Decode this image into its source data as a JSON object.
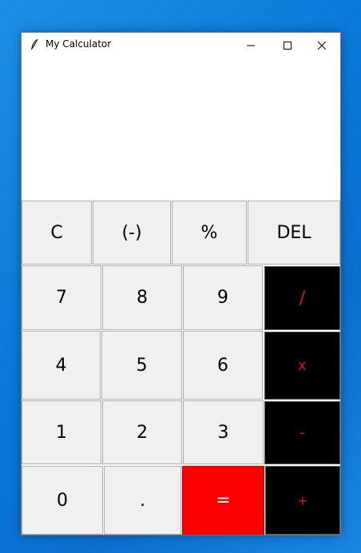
{
  "window": {
    "title": "My Calculator"
  },
  "display": {
    "value": ""
  },
  "buttons": {
    "clear": "C",
    "negate": "(-)",
    "percent": "%",
    "delete": "DEL",
    "seven": "7",
    "eight": "8",
    "nine": "9",
    "divide": "/",
    "four": "4",
    "five": "5",
    "six": "6",
    "multiply": "x",
    "one": "1",
    "two": "2",
    "three": "3",
    "minus": "-",
    "zero": "0",
    "decimal": ".",
    "equals": "=",
    "plus": "+"
  },
  "colors": {
    "operator_bg": "#000000",
    "operator_text": "#e01010",
    "equals_bg": "#ff0000",
    "equals_text": "#ffffff",
    "key_bg": "#f0f0f0"
  },
  "icons": {
    "app": "feather-icon",
    "minimize": "minimize-icon",
    "maximize": "maximize-icon",
    "close": "close-icon"
  }
}
